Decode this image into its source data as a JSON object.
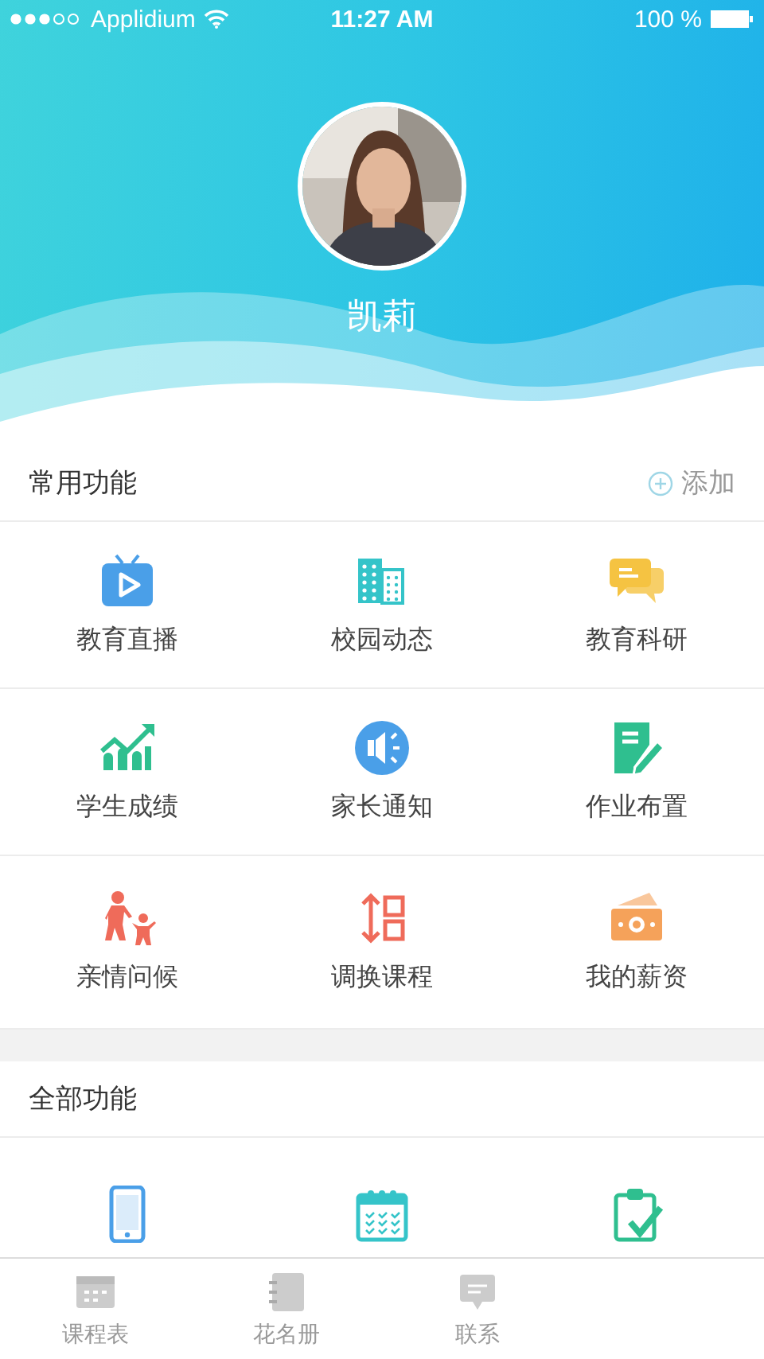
{
  "status_bar": {
    "carrier": "Applidium",
    "time": "11:27 AM",
    "battery": "100 %"
  },
  "profile": {
    "name": "凯莉"
  },
  "common_section": {
    "title": "常用功能",
    "add_label": "添加",
    "items": [
      {
        "label": "教育直播",
        "kind": "tv"
      },
      {
        "label": "校园动态",
        "kind": "building"
      },
      {
        "label": "教育科研",
        "kind": "chat"
      },
      {
        "label": "学生成绩",
        "kind": "chart"
      },
      {
        "label": "家长通知",
        "kind": "speaker"
      },
      {
        "label": "作业布置",
        "kind": "note"
      },
      {
        "label": "亲情问候",
        "kind": "family"
      },
      {
        "label": "调换课程",
        "kind": "swap"
      },
      {
        "label": "我的薪资",
        "kind": "money"
      }
    ]
  },
  "all_section": {
    "title": "全部功能",
    "items": [
      {
        "kind": "phone"
      },
      {
        "kind": "calendar"
      },
      {
        "kind": "clipboard"
      }
    ]
  },
  "tab_bar": [
    {
      "label": "课程表",
      "kind": "calendar",
      "selected": false
    },
    {
      "label": "花名册",
      "kind": "book",
      "selected": false
    },
    {
      "label": "联系",
      "kind": "chat",
      "selected": false
    }
  ]
}
